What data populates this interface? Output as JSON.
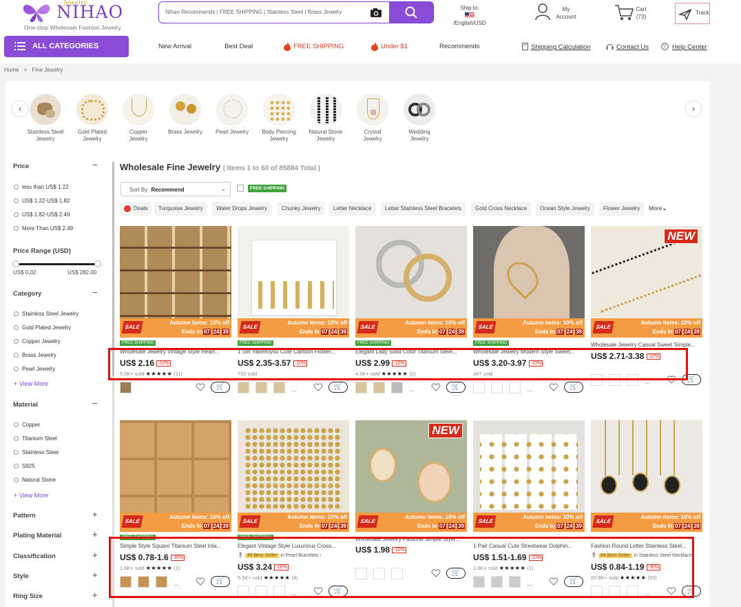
{
  "header": {
    "logo_text": "NIHAO",
    "logo_script": "Jewelry",
    "logo_tagline": "One-stop Wholesale Fashion Jewelry",
    "search_placeholder": "Nihao Recommends | FREE SHIPPING | Stainless Steel | Brass Jewelry",
    "ship_to_label": "Ship to:",
    "ship_to_value": "/English/USD",
    "account_line1": "My",
    "account_line2": "Account",
    "cart_label": "Cart",
    "cart_count": "(73)",
    "track_label": "Track"
  },
  "navbar": {
    "all_categories": "ALL CATEGORIES",
    "links": [
      "New Arrival",
      "Best Deal",
      "FREE SHIPPING",
      "Under $1",
      "Recommends"
    ],
    "right_links": [
      "Shipping Calculation",
      "Contact Us",
      "Help Center"
    ]
  },
  "breadcrumb": {
    "home": "Home",
    "sep": ">",
    "current": "Fine Jewelry"
  },
  "categories": [
    {
      "l1": "Stainless Steel",
      "l2": "Jewelry"
    },
    {
      "l1": "Gold Plated",
      "l2": "Jewelry"
    },
    {
      "l1": "Copper",
      "l2": "Jewelry"
    },
    {
      "l1": "Brass Jewelry",
      "l2": ""
    },
    {
      "l1": "Pearl Jewelry",
      "l2": ""
    },
    {
      "l1": "Body Piercing",
      "l2": "Jewelry"
    },
    {
      "l1": "Natural Stone",
      "l2": "Jewelry"
    },
    {
      "l1": "Crystal",
      "l2": "Jewelry"
    },
    {
      "l1": "Wedding",
      "l2": "Jewelry"
    }
  ],
  "sidebar": {
    "price_heading": "Price",
    "price_options": [
      "less than US$ 1.22",
      "US$ 1.22-US$ 1.82",
      "US$ 1.82-US$ 2.49",
      "More Than US$ 2.49"
    ],
    "price_range_heading": "Price Range (USD)",
    "price_range_min": "US$ 0.02",
    "price_range_max": "US$ 282.00",
    "category_heading": "Category",
    "category_options": [
      "Stainless Steel Jewelry",
      "Gold Plated Jewelry",
      "Copper Jewelry",
      "Brass Jewelry",
      "Pearl Jewelry"
    ],
    "view_more": "+ View More",
    "material_heading": "Material",
    "material_options": [
      "Copper",
      "Titanium Steel",
      "Stainless Steel",
      "S925",
      "Natural Stone"
    ],
    "collapsed": [
      "Pattern",
      "Plating Material",
      "Classification",
      "Style",
      "Ring Size"
    ]
  },
  "listing": {
    "title": "Wholesale Fine Jewelry",
    "count": "( Items 1 to 60 of 85884 Total )",
    "sort_label": "Sort By",
    "sort_value": "Recommend",
    "free_shipping_badge": "FREE SHIPPING",
    "tags": [
      "Deals",
      "Turquoise Jewelry",
      "Water Drops Jewelry",
      "Chunky Jewelry",
      "Letter Necklace",
      "Letter Stainless Steel Bracelets",
      "Gold Cross Necklace",
      "Ocean Style Jewelry",
      "Flower Jewelry"
    ],
    "more": "More"
  },
  "promo": {
    "sale": "SALE",
    "line1": "Autumn items: 10% off",
    "ends": "Ends In",
    "cd1": "07",
    "cd2": "24",
    "cd3": "39",
    "new": "NEW",
    "free_shipping": "FREE SHIPPING"
  },
  "products": [
    {
      "name": "Wholesale Jewelry Vintage Style Heart...",
      "price": "US$ 2.16",
      "discount": "-10%",
      "sold": "5.5K+ sold",
      "reviews": "(11)"
    },
    {
      "name": "1 Set Yakemiyou Cute Cartoon Flower...",
      "price": "US$ 2.35-3.57",
      "discount": "-10%",
      "sold": "732 sold",
      "reviews": ""
    },
    {
      "name": "Elegant Lady Solid Color Titanium Steel...",
      "price": "US$ 2.99",
      "discount": "-10%",
      "sold": "4.6K+ sold",
      "reviews": "(2)"
    },
    {
      "name": "Wholesale Jewelry Modern Style Sweet...",
      "price": "US$ 3.20-3.97",
      "discount": "-10%",
      "sold": "347 sold",
      "reviews": ""
    },
    {
      "name": "Wholesale Jewelry Casual Sweet Simple...",
      "price": "US$ 2.71-3.38",
      "discount": "-10%",
      "sold": "",
      "reviews": ""
    },
    {
      "name": "Simple Style Square Titanium Steel Inla...",
      "price": "US$ 0.78-1.6",
      "discount": "-30%",
      "sold": "1.6K+ sold",
      "reviews": "(1)"
    },
    {
      "name": "Elegant Vintage Style Luxurious Cross...",
      "price": "US$ 3.24",
      "discount": "-10%",
      "sold": "5.5K+ sold",
      "reviews": "(4)",
      "best": "#9 Best Seller",
      "best_in": "in Pearl Bracelets"
    },
    {
      "name": "Wholesale Jewelry Pastoral Simple Style...",
      "price": "US$ 1.98",
      "discount": "-10%",
      "sold": "",
      "reviews": ""
    },
    {
      "name": "1 Pair Casual Cute Streetwear Dolphin...",
      "price": "US$ 1.51-1.69",
      "discount": "-10%",
      "sold": "1.6K+ sold",
      "reviews": "(1)"
    },
    {
      "name": "Fashion Round Letter Stainless Steel...",
      "price": "US$ 0.84-1.19",
      "discount": "-30%",
      "sold": "60.8K+ sold",
      "reviews": "(63)",
      "best": "#4 Best Seller",
      "best_in": "in Stainless Steel Necklaces"
    }
  ],
  "stars": "★★★★★",
  "colors": {
    "brand_purple": "#8a4bd6",
    "sale_red": "#d32a1a",
    "promo_orange": "#f39c43",
    "free_ship_green": "#3fa33b",
    "highlight": "#e01010"
  }
}
